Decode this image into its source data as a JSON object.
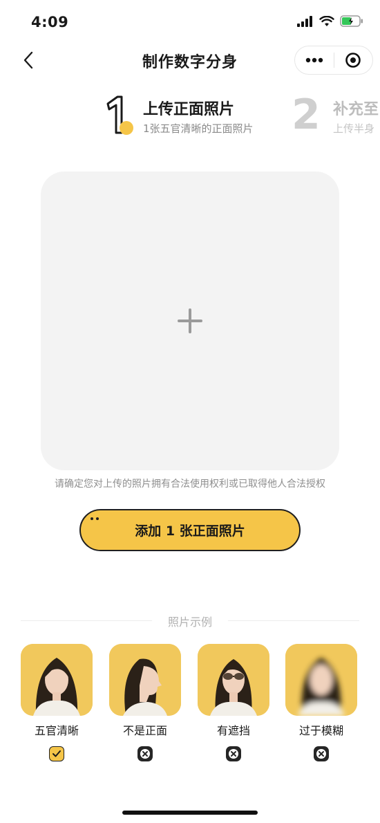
{
  "status_bar": {
    "time": "4:09"
  },
  "nav": {
    "title": "制作数字分身"
  },
  "steps": [
    {
      "number": "1",
      "title": "上传正面照片",
      "subtitle": "1张五官清晰的正面照片"
    },
    {
      "number": "2",
      "title": "补充至",
      "subtitle": "上传半身"
    }
  ],
  "upload": {
    "consent": "请确定您对上传的照片拥有合法使用权利或已取得他人合法授权"
  },
  "add_button": {
    "label": "添加 1 张正面照片"
  },
  "examples": {
    "title": "照片示例",
    "items": [
      {
        "label": "五官清晰",
        "status": "ok"
      },
      {
        "label": "不是正面",
        "status": "bad"
      },
      {
        "label": "有遮挡",
        "status": "bad"
      },
      {
        "label": "过于模糊",
        "status": "bad"
      }
    ]
  },
  "colors": {
    "accent": "#f5c548",
    "upload_bg": "#f3f3f3",
    "thumb_bg": "#f1c85c"
  }
}
